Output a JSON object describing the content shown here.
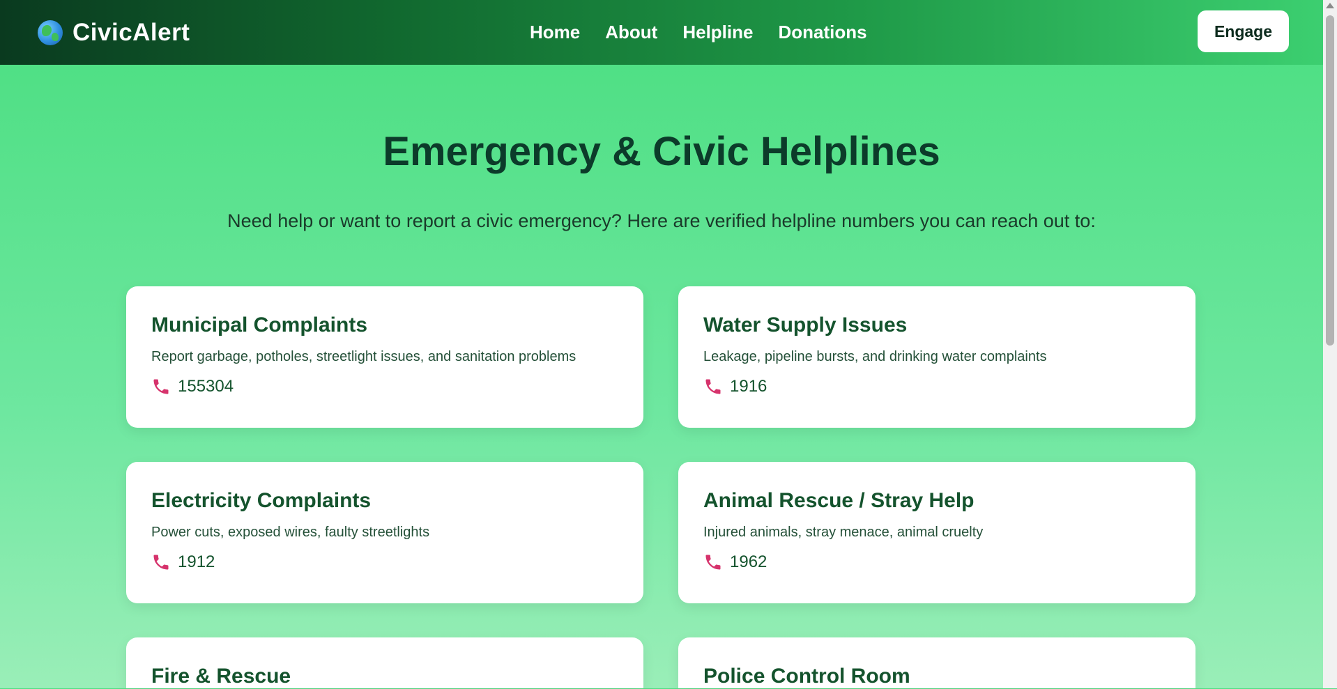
{
  "header": {
    "brand": "CivicAlert",
    "nav": [
      "Home",
      "About",
      "Helpline",
      "Donations"
    ],
    "cta": "Engage"
  },
  "main": {
    "title": "Emergency & Civic Helplines",
    "subtitle": "Need help or want to report a civic emergency? Here are verified helpline numbers you can reach out to:",
    "cards": [
      {
        "title": "Municipal Complaints",
        "desc": "Report garbage, potholes, streetlight issues, and sanitation problems",
        "phone": "155304"
      },
      {
        "title": "Water Supply Issues",
        "desc": "Leakage, pipeline bursts, and drinking water complaints",
        "phone": "1916"
      },
      {
        "title": "Electricity Complaints",
        "desc": "Power cuts, exposed wires, faulty streetlights",
        "phone": "1912"
      },
      {
        "title": "Animal Rescue / Stray Help",
        "desc": "Injured animals, stray menace, animal cruelty",
        "phone": "1962"
      },
      {
        "title": "Fire & Rescue",
        "desc": "",
        "phone": ""
      },
      {
        "title": "Police Control Room",
        "desc": "",
        "phone": ""
      }
    ]
  },
  "icons": {
    "logo": "globe-icon",
    "phone": "phone-icon"
  },
  "colors": {
    "accent": "#4ade80",
    "heading": "#0c3b2a",
    "phone_icon": "#d6336c"
  }
}
